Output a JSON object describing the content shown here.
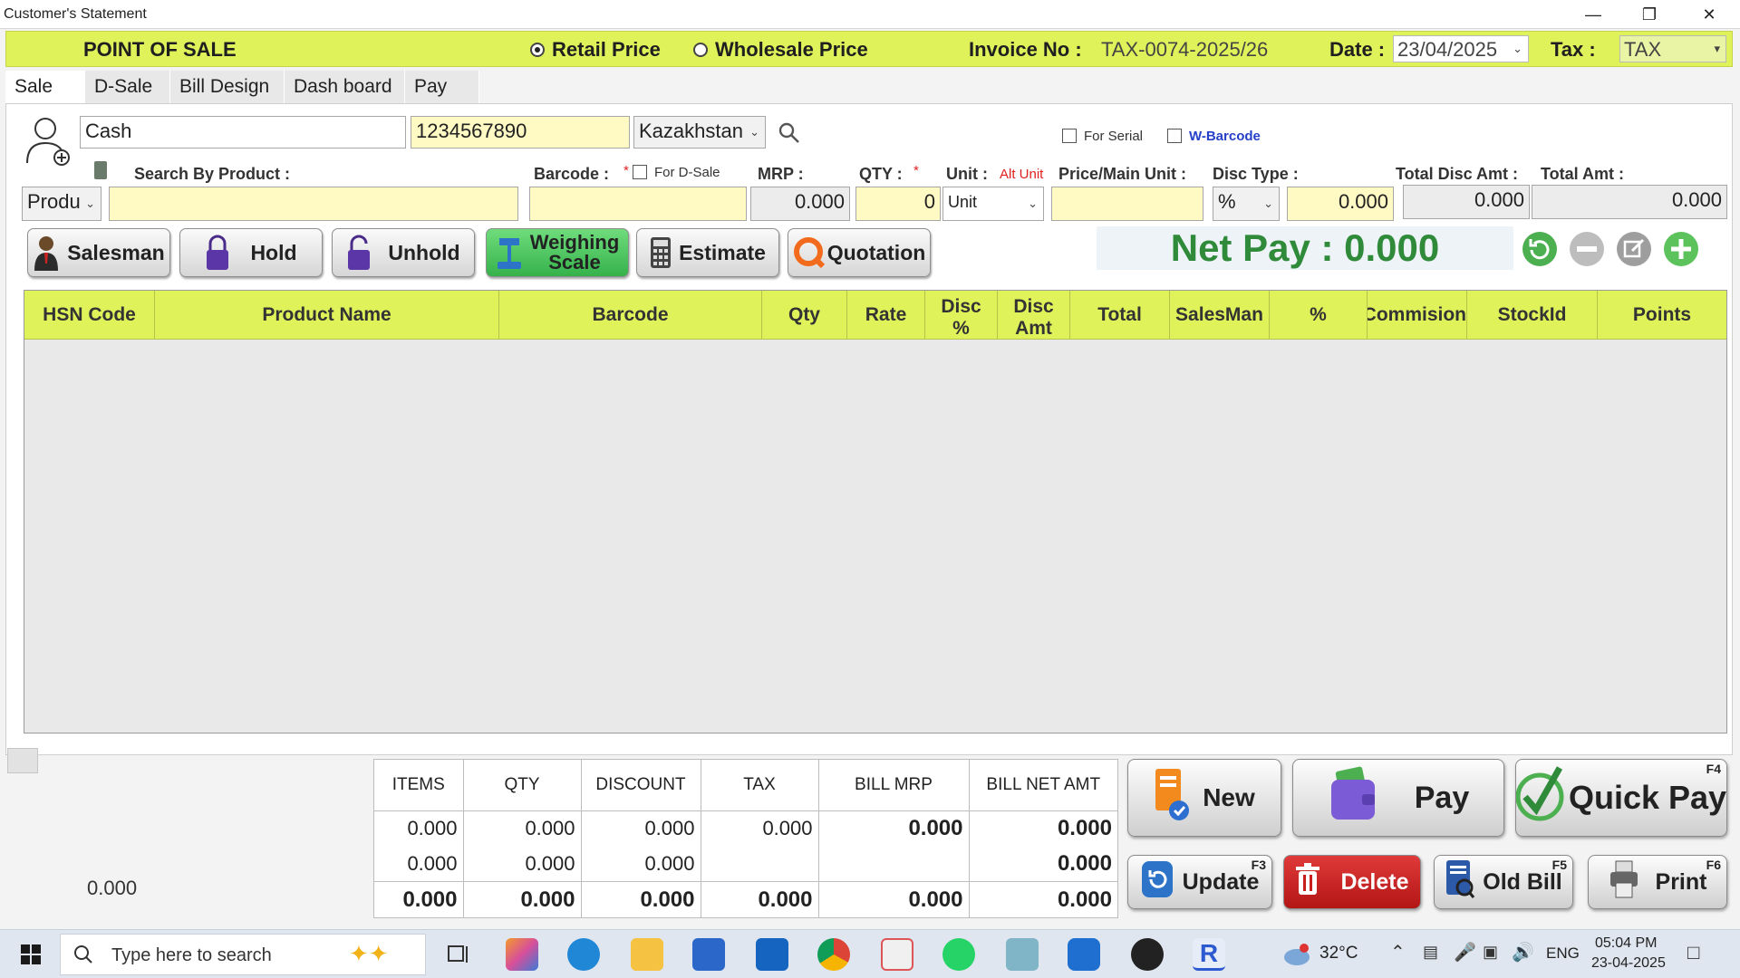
{
  "window": {
    "title": "Customer's Statement"
  },
  "header": {
    "title": "POINT OF SALE",
    "price_modes": [
      "Retail Price",
      "Wholesale Price"
    ],
    "selected_price_mode": "Retail Price",
    "invoice_label": "Invoice No :",
    "invoice_no": "TAX-0074-2025/26",
    "date_label": "Date :",
    "date_value": "23/04/2025",
    "tax_label": "Tax :",
    "tax_value": "TAX"
  },
  "tabs": [
    "Sale",
    "D-Sale",
    "Bill Design",
    "Dash board",
    "Pay"
  ],
  "active_tab": "Sale",
  "customer": {
    "name": "Cash",
    "phone": "1234567890",
    "country": "Kazakhstan"
  },
  "options": {
    "for_serial": "For Serial",
    "w_barcode": "W-Barcode"
  },
  "entry": {
    "search_label": "Search By Product :",
    "search_mode": "Produ",
    "barcode_label": "Barcode :",
    "for_dsale": "For D-Sale",
    "mrp_label": "MRP :",
    "mrp_value": "0.000",
    "qty_label": "QTY :",
    "qty_value": "0",
    "unit_label": "Unit :",
    "alt_unit": "Alt Unit",
    "unit_value": "Unit",
    "price_label": "Price/Main Unit :",
    "disc_type_label": "Disc Type :",
    "disc_type_value": "%",
    "disc_value": "0.000",
    "total_disc_label": "Total Disc Amt :",
    "total_disc_value": "0.000",
    "total_amt_label": "Total Amt :",
    "total_amt_value": "0.000",
    "required_mark": "*"
  },
  "actions": {
    "salesman": "Salesman",
    "hold": "Hold",
    "unhold": "Unhold",
    "weighing_1": "Weighing",
    "weighing_2": "Scale",
    "estimate": "Estimate",
    "quotation": "Quotation"
  },
  "net_pay": "Net Pay : 0.000",
  "grid": {
    "columns": [
      "HSN Code",
      "Product Name",
      "Barcode",
      "Qty",
      "Rate",
      "Disc %",
      "Disc Amt",
      "Total",
      "SalesMan",
      "%",
      "Commision",
      "StockId",
      "Points"
    ]
  },
  "summary": {
    "headers": [
      "ITEMS",
      "QTY",
      "DISCOUNT",
      "TAX",
      "BILL MRP",
      "BILL NET AMT"
    ],
    "rows": [
      [
        "0.000",
        "0.000",
        "0.000",
        "0.000",
        "0.000",
        "0.000"
      ],
      [
        "0.000",
        "0.000",
        "0.000",
        "",
        "",
        "0.000"
      ],
      [
        "0.000",
        "0.000",
        "0.000",
        "0.000",
        "0.000",
        "0.000"
      ]
    ],
    "left_value": "0.000"
  },
  "bottom_buttons": {
    "new": "New",
    "pay": "Pay",
    "quick_pay": "Quick Pay",
    "quick_pay_key": "F4",
    "update": "Update",
    "update_key": "F3",
    "delete": "Delete",
    "old_bill": "Old Bill",
    "old_bill_key": "F5",
    "print": "Print",
    "print_key": "F6"
  },
  "taskbar": {
    "search_placeholder": "Type here to search",
    "temperature": "32°C",
    "language": "ENG",
    "time": "05:04 PM",
    "date": "23-04-2025"
  },
  "colors": {
    "header": "#dff25a",
    "net_pay": "#2f8a3a",
    "delete": "#c81e1e",
    "alt_unit": "#e02020",
    "w_barcode": "#2740c8"
  }
}
